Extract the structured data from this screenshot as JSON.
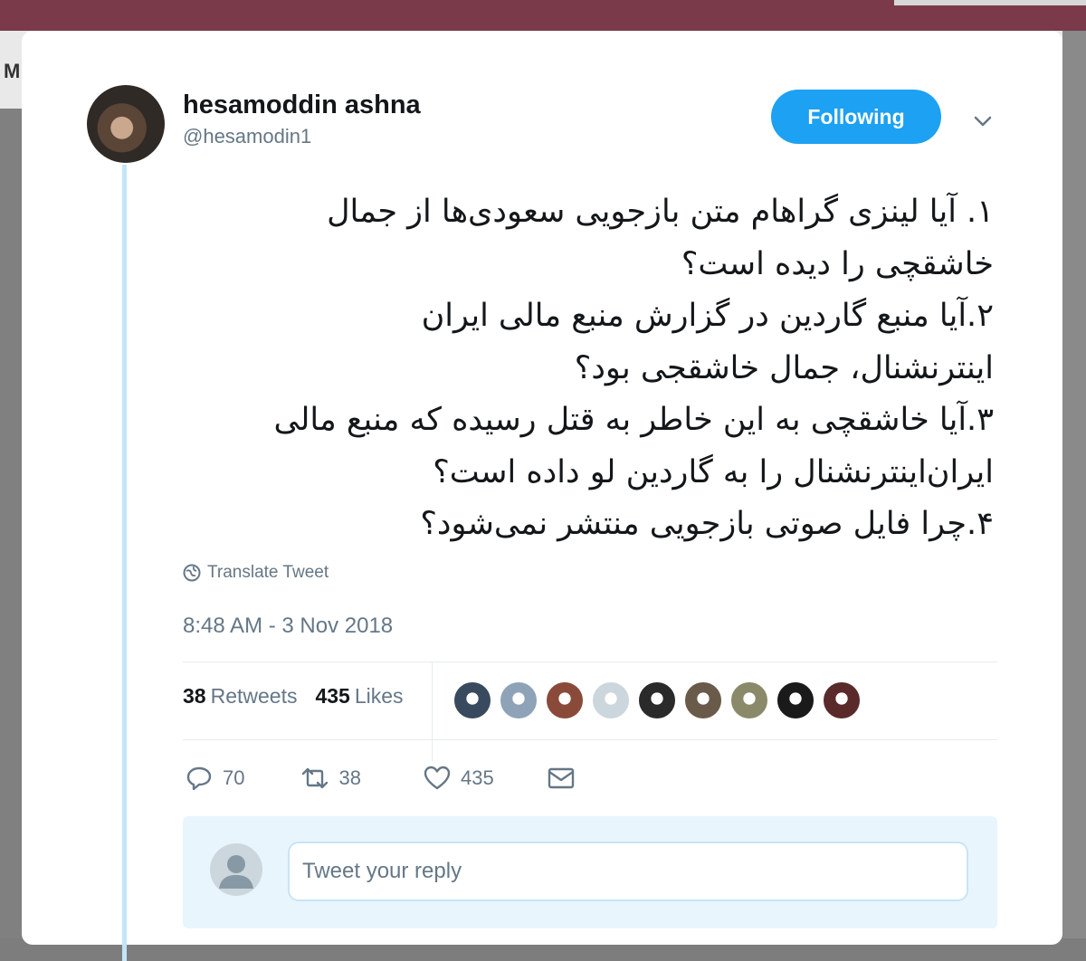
{
  "tweet": {
    "author_name": "hesamoddin ashna",
    "author_handle": "@hesamodin1",
    "follow_label": "Following",
    "text_lines": [
      "۱. آیا لینزی گراهام متن بازجویی سعودی‌ها از جمال",
      "خاشقچی را دیده است؟",
      "۲.آیا منبع گاردین در گزارش منبع مالی ایران",
      "اینترنشنال،  جمال خاشقجی بود؟",
      "۳.آیا  خاشقچی به این خاطر به قتل رسیده که منبع مالی",
      "ایران‌اینترنشنال را به گاردین لو داده است؟",
      "۴.چرا فایل صوتی بازجویی  منتشر نمی‌شود؟"
    ],
    "translate_label": "Translate Tweet",
    "timestamp": "8:48 AM - 3 Nov 2018",
    "stats": {
      "retweets_count": "38",
      "retweets_label": "Retweets",
      "likes_count": "435",
      "likes_label": "Likes"
    },
    "liker_avatar_colors": [
      "#3a4a5e",
      "#8fa3b8",
      "#8a4a3a",
      "#ccd6dd",
      "#2a2a2a",
      "#6a5a4a",
      "#8a8a6a",
      "#1a1a1a",
      "#5a2a2a"
    ],
    "actions": {
      "reply_count": "70",
      "retweet_count": "38",
      "like_count": "435"
    },
    "reply_placeholder": "Tweet your reply"
  },
  "background": {
    "left_letter": "M"
  },
  "colors": {
    "accent": "#1da1f2",
    "text_primary": "#14171a",
    "text_secondary": "#657786"
  }
}
